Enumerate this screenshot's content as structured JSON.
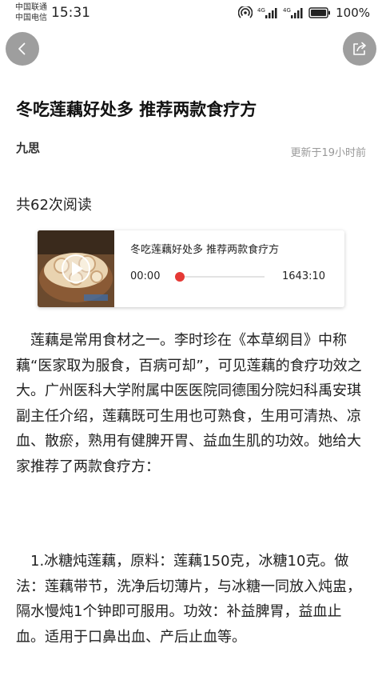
{
  "status_bar": {
    "carrier_1": "中国联通",
    "carrier_2": "中国电信",
    "time": "15:31",
    "battery_percent": "100%",
    "icons": [
      "hotspot-icon",
      "signal-4g-icon",
      "signal-4g-icon",
      "battery-icon"
    ]
  },
  "nav": {
    "back_icon": "chevron-left-icon",
    "share_icon": "share-icon"
  },
  "article": {
    "title": "冬吃莲藕好处多 推荐两款食疗方",
    "author": "九思",
    "updated": "更新于19小时前",
    "read_count": "共62次阅读",
    "paragraphs": [
      "莲藕是常用食材之一。李时珍在《本草纲目》中称藕“医家取为服食，百病可却”，可见莲藕的食疗功效之大。广州医科大学附属中医医院同德围分院妇科禹安琪副主任介绍，莲藕既可生用也可熟食，生用可清热、凉血、散瘀，熟用有健脾开胃、益血生肌的功效。她给大家推荐了两款食疗方：",
      "1.冰糖炖莲藕，原料：莲藕150克，冰糖10克。做法：莲藕带节，洗净后切薄片，与冰糖一同放入炖盅，隔水慢炖1个钟即可服用。功效：补益脾胃，益血止血。适用于口鼻出血、产后止血等。"
    ]
  },
  "audio": {
    "title": "冬吃莲藕好处多 推荐两款食疗方",
    "current_time": "00:00",
    "total_time": "1643:10",
    "progress": 0,
    "accent_color": "#e53935"
  }
}
